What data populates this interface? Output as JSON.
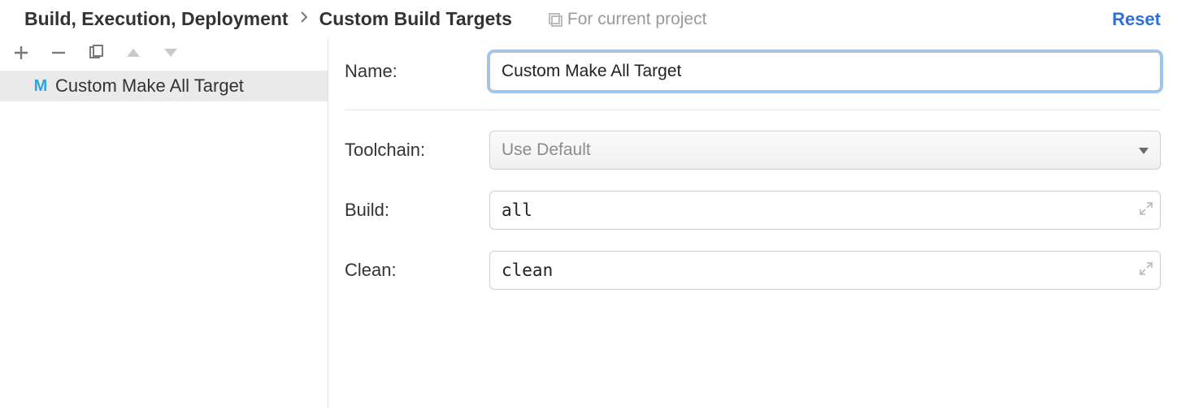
{
  "breadcrumb": {
    "parent": "Build, Execution, Deployment",
    "current": "Custom Build Targets"
  },
  "scope_label": "For current project",
  "reset_label": "Reset",
  "sidebar": {
    "items": [
      {
        "icon": "M",
        "label": "Custom Make All Target"
      }
    ]
  },
  "form": {
    "name_label": "Name:",
    "name_value": "Custom Make All Target",
    "toolchain_label": "Toolchain:",
    "toolchain_value": "Use Default",
    "build_label": "Build:",
    "build_value": "all",
    "clean_label": "Clean:",
    "clean_value": "clean"
  }
}
